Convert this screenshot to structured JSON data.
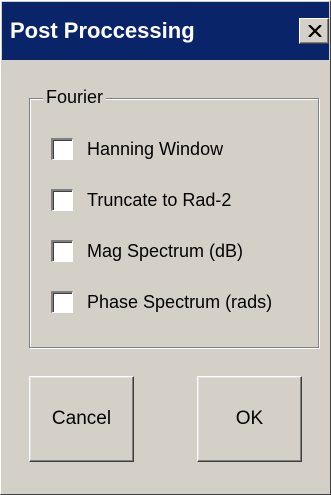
{
  "dialog": {
    "title": "Post Proccessing",
    "close_icon": "close-icon"
  },
  "fourier_group": {
    "legend": "Fourier",
    "options": [
      {
        "label": "Hanning Window",
        "checked": false
      },
      {
        "label": "Truncate to Rad-2",
        "checked": false
      },
      {
        "label": "Mag Spectrum (dB)",
        "checked": false
      },
      {
        "label": "Phase Spectrum (rads)",
        "checked": false
      }
    ]
  },
  "buttons": {
    "cancel_label": "Cancel",
    "ok_label": "OK"
  },
  "colors": {
    "titlebar": "#0a246a",
    "face": "#d4d0c8"
  }
}
